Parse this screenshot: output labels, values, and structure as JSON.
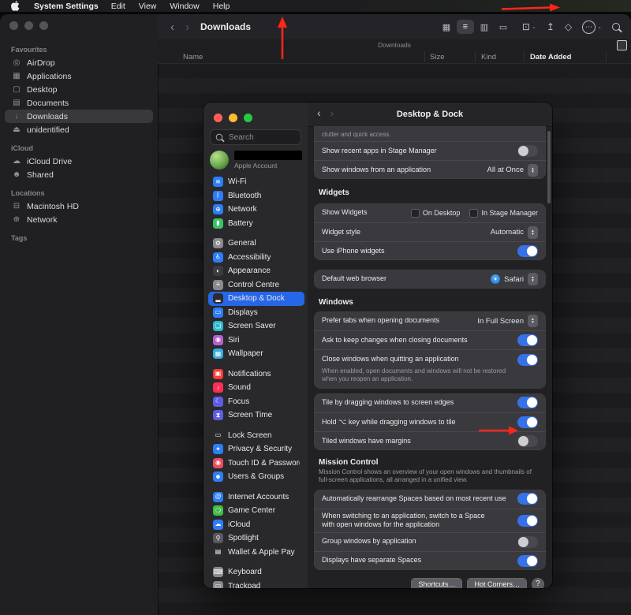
{
  "colors": {
    "accent_blue": "#3671E8",
    "selection_blue": "#2667E7",
    "annotation_arrow_red": "#FF2619"
  },
  "menu_bar": {
    "app_name": "System Settings",
    "menus": [
      "Edit",
      "View",
      "Window",
      "Help"
    ]
  },
  "finder": {
    "toolbar": {
      "title": "Downloads"
    },
    "path_bar": {
      "label": "Downloads"
    },
    "columns": [
      "Name",
      "Size",
      "Kind",
      "Date Added"
    ],
    "sidebar": {
      "sections": [
        {
          "header": "Favourites",
          "items": [
            {
              "label": "AirDrop",
              "glyph": "◎"
            },
            {
              "label": "Applications",
              "glyph": "▦"
            },
            {
              "label": "Desktop",
              "glyph": "▢"
            },
            {
              "label": "Documents",
              "glyph": "▤"
            },
            {
              "label": "Downloads",
              "glyph": "↓",
              "selected": true
            },
            {
              "label": "unidentified",
              "glyph": "⏏"
            }
          ]
        },
        {
          "header": "iCloud",
          "items": [
            {
              "label": "iCloud Drive",
              "glyph": "☁"
            },
            {
              "label": "Shared",
              "glyph": "☻"
            }
          ]
        },
        {
          "header": "Locations",
          "items": [
            {
              "label": "Macintosh HD",
              "glyph": "⊟"
            },
            {
              "label": "Network",
              "glyph": "⊕"
            }
          ]
        },
        {
          "header": "Tags",
          "items": []
        }
      ]
    }
  },
  "settings": {
    "window_title": "Desktop & Dock",
    "search": {
      "placeholder": "Search"
    },
    "account": {
      "label": "Apple Account"
    },
    "sidebar_items": [
      {
        "label": "Wi-Fi",
        "glyph": "≋",
        "color": "#2D7DF6"
      },
      {
        "label": "Bluetooth",
        "glyph": "ᛒ",
        "color": "#2D7DF6"
      },
      {
        "label": "Network",
        "glyph": "⊕",
        "color": "#2D7DF6"
      },
      {
        "label": "Battery",
        "glyph": "▮",
        "color": "#39C463"
      },
      {
        "label": "General",
        "glyph": "⚙",
        "color": "#8A8A8E",
        "gap": true
      },
      {
        "label": "Accessibility",
        "glyph": "♿",
        "color": "#2D7DF6"
      },
      {
        "label": "Appearance",
        "glyph": "◐",
        "color": "#3C3C40"
      },
      {
        "label": "Control Centre",
        "glyph": "≡",
        "color": "#8A8A8E"
      },
      {
        "label": "Desktop & Dock",
        "glyph": "▂",
        "color": "#2B2B2E",
        "selected": true
      },
      {
        "label": "Displays",
        "glyph": "▭",
        "color": "#2D7DF6"
      },
      {
        "label": "Screen Saver",
        "glyph": "❏",
        "color": "#2FB8CC"
      },
      {
        "label": "Siri",
        "glyph": "◉",
        "color": "#B35FD1"
      },
      {
        "label": "Wallpaper",
        "glyph": "▦",
        "color": "#35ADE2"
      },
      {
        "label": "Notifications",
        "glyph": "▣",
        "color": "#FC3D39",
        "gap": true
      },
      {
        "label": "Sound",
        "glyph": "♪",
        "color": "#FF2D55"
      },
      {
        "label": "Focus",
        "glyph": "☾",
        "color": "#5D5CE5"
      },
      {
        "label": "Screen Time",
        "glyph": "⧗",
        "color": "#5D5CE5"
      },
      {
        "label": "Lock Screen",
        "glyph": "▭",
        "color": "#2B2B2E",
        "gap": true
      },
      {
        "label": "Privacy & Security",
        "glyph": "✦",
        "color": "#2D7DF6"
      },
      {
        "label": "Touch ID & Password",
        "glyph": "◉",
        "color": "#EB4B63"
      },
      {
        "label": "Users & Groups",
        "glyph": "☻",
        "color": "#2D7DF6"
      },
      {
        "label": "Internet Accounts",
        "glyph": "@",
        "color": "#2D7DF6",
        "gap": true
      },
      {
        "label": "Game Center",
        "glyph": "❍",
        "color": "#43BE4A"
      },
      {
        "label": "iCloud",
        "glyph": "☁",
        "color": "#2D7DF6"
      },
      {
        "label": "Spotlight",
        "glyph": "⚲",
        "color": "#59595E"
      },
      {
        "label": "Wallet & Apple Pay",
        "glyph": "▤",
        "color": "#2B2B2E"
      },
      {
        "label": "Keyboard",
        "glyph": "⌨",
        "color": "#8A8A8E",
        "gap": true
      },
      {
        "label": "Trackpad",
        "glyph": "▭",
        "color": "#8A8A8E"
      }
    ],
    "panel": {
      "stage_group": {
        "partial_text": "clutter and quick access.",
        "rows": [
          {
            "label": "Show recent apps in Stage Manager",
            "on": false
          },
          {
            "label": "Show windows from an application",
            "value": "All at Once"
          }
        ]
      },
      "widgets_section": {
        "header": "Widgets",
        "rows": [
          {
            "label": "Show Widgets",
            "options": [
              {
                "label": "On Desktop",
                "checked": false
              },
              {
                "label": "In Stage Manager",
                "checked": false
              }
            ]
          },
          {
            "label": "Widget style",
            "value": "Automatic"
          },
          {
            "label": "Use iPhone widgets",
            "on": true
          }
        ]
      },
      "browser_group": {
        "rows": [
          {
            "label": "Default web browser",
            "value": "Safari"
          }
        ]
      },
      "windows_section": {
        "header": "Windows",
        "group_a": [
          {
            "label": "Prefer tabs when opening documents",
            "value": "In Full Screen"
          },
          {
            "label": "Ask to keep changes when closing documents",
            "on": true
          },
          {
            "label": "Close windows when quitting an application",
            "on": true,
            "description": "When enabled, open documents and windows will not be restored when you reopen an application."
          }
        ],
        "group_b": [
          {
            "label": "Tile by dragging windows to screen edges",
            "on": true
          },
          {
            "label": "Hold ⌥ key while dragging windows to tile",
            "on": true
          },
          {
            "label": "Tiled windows have margins",
            "on": false
          }
        ]
      },
      "mission_section": {
        "header": "Mission Control",
        "description": "Mission Control shows an overview of your open windows and thumbnails of full-screen applications, all arranged in a unified view.",
        "rows": [
          {
            "label": "Automatically rearrange Spaces based on most recent use",
            "on": true
          },
          {
            "label": "When switching to an application, switch to a Space with open windows for the application",
            "on": true
          },
          {
            "label": "Group windows by application",
            "on": false
          },
          {
            "label": "Displays have separate Spaces",
            "on": true
          }
        ]
      },
      "footer": {
        "shortcuts": "Shortcuts…",
        "hot_corners": "Hot Corners…",
        "help": "?"
      }
    }
  },
  "annotations": {
    "arrows": [
      {
        "target": "menu-bar-right",
        "direction": "right"
      },
      {
        "target": "finder-toolbar",
        "direction": "up"
      },
      {
        "target": "tiled-windows-margins-toggle",
        "direction": "right"
      }
    ]
  }
}
